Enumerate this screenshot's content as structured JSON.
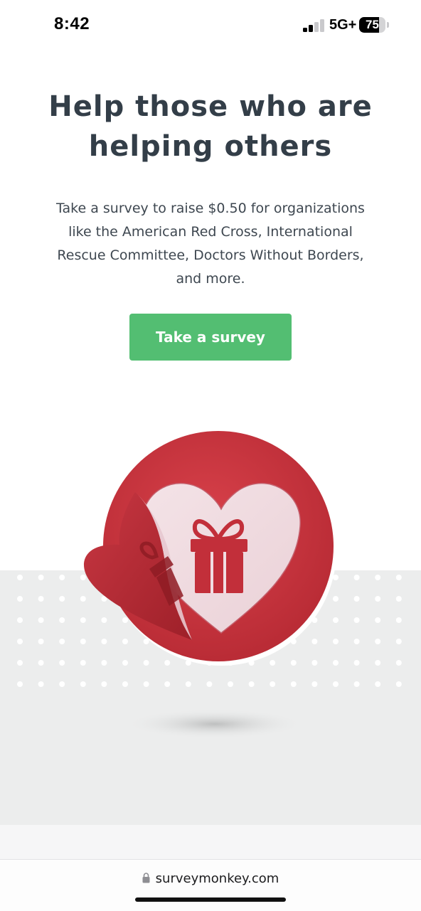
{
  "status_bar": {
    "time": "8:42",
    "network": "5G+",
    "battery": "75",
    "battery_fraction": 0.75,
    "signal_bars_active": 2,
    "signal_bars_total": 4
  },
  "hero": {
    "headline": "Help those who are helping others",
    "subtext": "Take a survey to raise $0.50 for organizations like the American Red Cross, International Rescue Committee, Doctors Without Borders, and more.",
    "cta_label": "Take a survey"
  },
  "illustration": {
    "icon": "heart-gift-icon"
  },
  "browser": {
    "url": "surveymonkey.com",
    "lock_icon": "lock-icon"
  },
  "colors": {
    "text": "#333e48",
    "cta": "#53be72",
    "badge_red": "#c9353d",
    "band_gray": "#eceded"
  }
}
